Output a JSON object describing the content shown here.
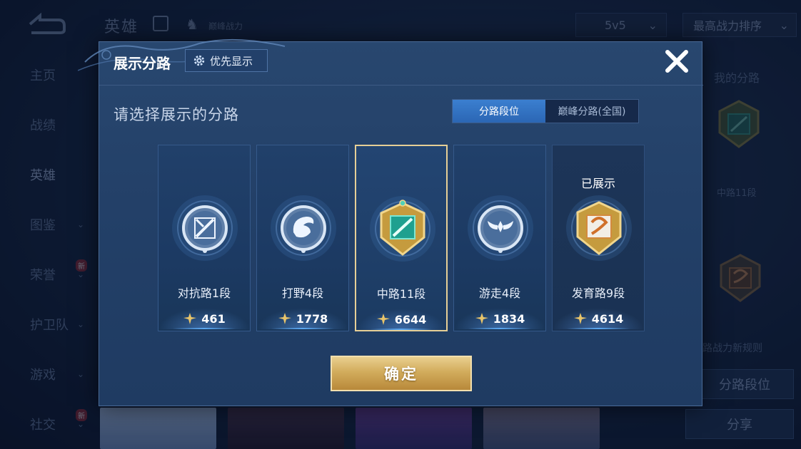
{
  "background": {
    "top_title": "英雄",
    "peak_label": "巅峰战力",
    "mode_select": "5v5",
    "sort_select": "最高战力排序",
    "sidebar": [
      {
        "label": "主页",
        "has_chevron": false,
        "new": false
      },
      {
        "label": "战绩",
        "has_chevron": false,
        "new": false
      },
      {
        "label": "英雄",
        "has_chevron": false,
        "new": false,
        "active": true
      },
      {
        "label": "图鉴",
        "has_chevron": true,
        "new": false
      },
      {
        "label": "荣誉",
        "has_chevron": true,
        "new": true
      },
      {
        "label": "护卫队",
        "has_chevron": true,
        "new": false
      },
      {
        "label": "游戏",
        "has_chevron": true,
        "new": false
      },
      {
        "label": "社交",
        "has_chevron": true,
        "new": true
      }
    ],
    "new_badge": "新",
    "right_panel": {
      "title": "我的分路",
      "emblem1_label": "中路11段",
      "rule_text": "分路战力新规则",
      "button1": "分路段位",
      "button2": "分享"
    }
  },
  "modal": {
    "title": "展示分路",
    "priority_button": "优先显示",
    "prompt": "请选择展示的分路",
    "tabs": [
      {
        "label": "分路段位",
        "active": true
      },
      {
        "label": "巅峰分路(全国)",
        "active": false
      }
    ],
    "lanes": [
      {
        "name": "对抗路1段",
        "power": "461",
        "emblem": "clash-lane-emblem-icon",
        "selected": false,
        "shown": false
      },
      {
        "name": "打野4段",
        "power": "1778",
        "emblem": "jungle-emblem-icon",
        "selected": false,
        "shown": false
      },
      {
        "name": "中路11段",
        "power": "6644",
        "emblem": "mid-lane-emblem-icon",
        "selected": true,
        "shown": false
      },
      {
        "name": "游走4段",
        "power": "1834",
        "emblem": "roam-emblem-icon",
        "selected": false,
        "shown": false
      },
      {
        "name": "发育路9段",
        "power": "4614",
        "emblem": "farm-lane-emblem-icon",
        "selected": false,
        "shown": true
      }
    ],
    "shown_label": "已展示",
    "confirm_button": "确定"
  },
  "colors": {
    "selected_border": "#e6cf96",
    "confirm_gold": "#d2ac5c",
    "tab_active": "#2b66b4"
  }
}
